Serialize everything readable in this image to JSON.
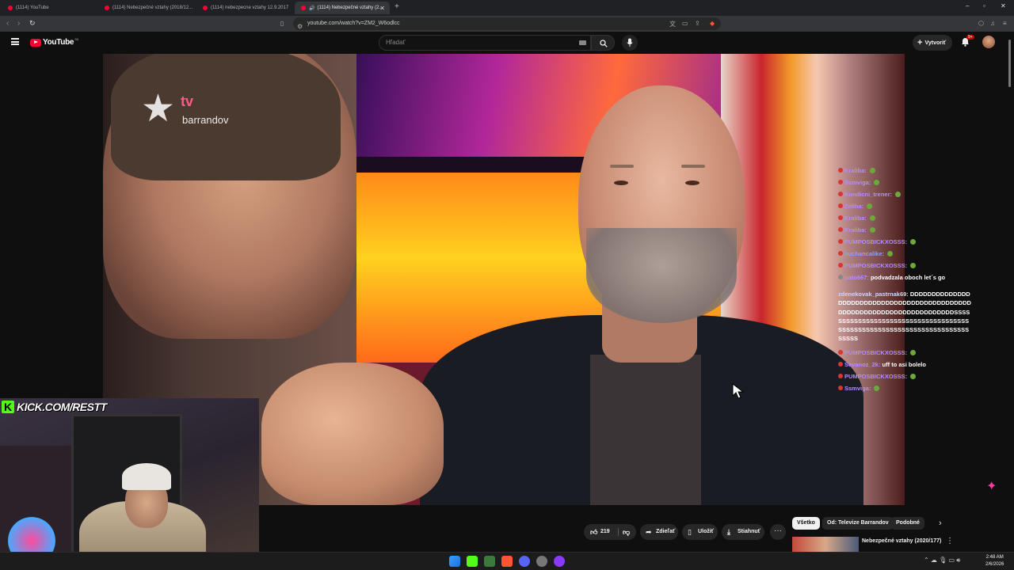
{
  "browser": {
    "tabs": [
      {
        "label": "(1114) YouTube",
        "active": false
      },
      {
        "label": "(1114) Nebezpečné vztahy (2018/12...",
        "active": false
      },
      {
        "label": "(1114) nebezpecne vztahy 12.9.2017",
        "active": false
      },
      {
        "label": "(1114) Nebezpečné vztahy (2...",
        "active": true
      }
    ],
    "new_tab": "+",
    "url": "youtube.com/watch?v=ZM2_W6odlcc"
  },
  "youtube": {
    "logo_text": "YouTube",
    "country_code": "SK",
    "search_placeholder": "Hľadať",
    "create_label": "Vytvoriť",
    "notification_badge": "9+"
  },
  "video": {
    "channel_watermark_tv": "tv",
    "channel_watermark_name": "barrandov"
  },
  "chat": {
    "lines": [
      {
        "user": "Kraliba:",
        "color": "#b48cff",
        "msg": ""
      },
      {
        "user": "Ssmviga:",
        "color": "#b48cff",
        "msg": ""
      },
      {
        "user": "Kundicni_trener:",
        "color": "#b48cff",
        "msg": ""
      },
      {
        "user": "Zeliha:",
        "color": "#b48cff",
        "msg": ""
      },
      {
        "user": "Kraliba:",
        "color": "#b48cff",
        "msg": ""
      },
      {
        "user": "Kraliba:",
        "color": "#b48cff",
        "msg": ""
      },
      {
        "user": "PUMPOSBICKXOSSS:",
        "color": "#b48cff",
        "msg": ""
      },
      {
        "user": "buchancalike:",
        "color": "#8aa0ff",
        "msg": ""
      },
      {
        "user": "PUMPOSBICKXOSSS:",
        "color": "#b48cff",
        "msg": ""
      },
      {
        "user": "pato667:",
        "color": "#b48cff",
        "msg": "podvadzala oboch let´s go"
      }
    ],
    "multi": {
      "user": "zdenekovak_pastrnak69:",
      "msg": "DDDDDDDDDDDDDDDDDDDDDDDDDDDDDDDDDDDDDDDDDDDDDDDDDDDDDDDDDDDDDDDDDDDDDDDDSSSSSSSSSSSSSSSSSSSSSSSSSSSSSSSSSSSSSSSSSSSSSSSSSSSSSSSSSSSSSSSSSSSSSSSSSSS"
    },
    "lines2": [
      {
        "user": "PUMPOSBICKXOSSS:",
        "color": "#b48cff",
        "msg": ""
      },
      {
        "user": "Sevanoz_2k:",
        "color": "#b48cff",
        "msg": "uff to asi bolelo"
      },
      {
        "user": "PUMPOSBICKXOSSS:",
        "color": "#b48cff",
        "msg": ""
      },
      {
        "user": "Ssmviga:",
        "color": "#b48cff",
        "msg": ""
      }
    ]
  },
  "webcam": {
    "kick_letter": "K",
    "kick_text": "KICK.COM/RESTT"
  },
  "actions": {
    "like_count": "219",
    "share": "Zdieľať",
    "save": "Uložiť",
    "download": "Stiahnuť",
    "more": "···"
  },
  "chips": [
    {
      "label": "Všetko",
      "selected": true
    },
    {
      "label": "Od: Televize Barrandov",
      "selected": false
    },
    {
      "label": "Podobné",
      "selected": false
    }
  ],
  "recommendation": {
    "title": "Nebezpečné vztahy (2020/177)"
  },
  "taskbar": {
    "time": "2:48 AM",
    "date": "2/6/2026"
  },
  "colors": {
    "youtube_red": "#ff0033",
    "kick_green": "#53fc18",
    "page_bg": "#0f0f0f"
  }
}
